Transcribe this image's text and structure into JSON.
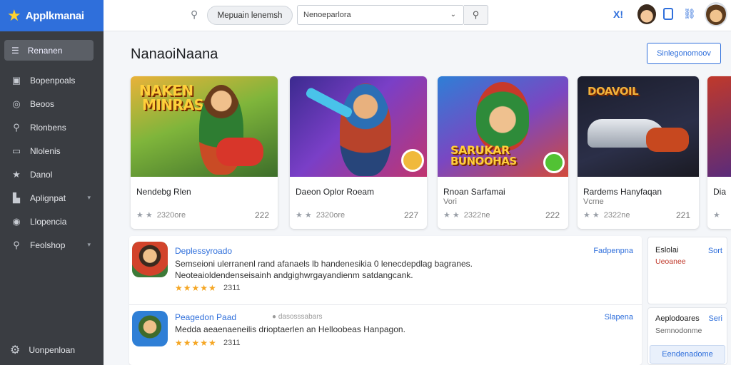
{
  "app": {
    "name": "Applkmanai",
    "logo_icon": "star-icon"
  },
  "sidebar": {
    "active": {
      "label": "Renanen",
      "icon": "menu-icon"
    },
    "items": [
      {
        "label": "Bopenpoals",
        "icon": "inbox-icon",
        "chevron": false
      },
      {
        "label": "Beoos",
        "icon": "bulb-icon",
        "chevron": false
      },
      {
        "label": "Rlonbens",
        "icon": "key-icon",
        "chevron": false
      },
      {
        "label": "Nlolenis",
        "icon": "tablet-icon",
        "chevron": false
      },
      {
        "label": "Danol",
        "icon": "star-icon",
        "chevron": false
      },
      {
        "label": "Aplignpat",
        "icon": "building-icon",
        "chevron": true
      },
      {
        "label": "Llopencia",
        "icon": "circle-icon",
        "chevron": false
      },
      {
        "label": "Feolshop",
        "icon": "search-icon",
        "chevron": true
      }
    ],
    "bottom": {
      "label": "Uonpenloan",
      "icon": "gear-icon"
    }
  },
  "topbar": {
    "pill": "Mepuain lenemsh",
    "select_value": "Nenoeparlora",
    "icon_x": "X!"
  },
  "main": {
    "title": "NanaoiNaana",
    "top_button": "Sinlegonomoov",
    "cards": [
      {
        "headline1": "NAKEN",
        "headline2": "MINRAS",
        "title": "Nendebg Rlen",
        "sub": "",
        "rating": "2320ore",
        "count": "222"
      },
      {
        "headline1": "",
        "headline2": "",
        "title": "Daeon Oplor Roeam",
        "sub": "",
        "rating": "2320ore",
        "count": "227"
      },
      {
        "headline1": "SARUKAR",
        "headline2": "BUNOOHAS",
        "title": "Rnoan Sarfamai",
        "sub": "Vori",
        "rating": "2322ne",
        "count": "222"
      },
      {
        "headline1": "DOAVOIL",
        "headline2": "",
        "title": "Rardems Hanyfaqan",
        "sub": "Vcrne",
        "rating": "2322ne",
        "count": "221"
      },
      {
        "headline1": "",
        "headline2": "",
        "title": "Dia",
        "sub": "",
        "rating": "",
        "count": ""
      }
    ],
    "list": [
      {
        "name": "Deplessyroado",
        "tag": "",
        "desc": "Semseioni ulerranenl rand afanaels lb handenesikia 0 lenecdepdlag bagranes. Neoteaioldendenseisainh andgighwrgayandienm satdangcank.",
        "stars": "★★★★★",
        "reviews": "2311",
        "action": "Fadpenpna"
      },
      {
        "name": "Peagedon Paad",
        "tag": "● dasosssabars",
        "desc": "Medda aeaenaeneilis drioptaerlen an Helloobeas Hanpagon.",
        "stars": "★★★★★",
        "reviews": "2311",
        "action": "Slapena"
      }
    ],
    "panel1": {
      "heading": "Eslolai",
      "action": "Sort",
      "red": "Ueoanee"
    },
    "panel2": {
      "heading": "Aeplodoares",
      "action": "Seri",
      "sub": "Semnodonme",
      "button": "Eendenadome"
    }
  },
  "colors": {
    "accent": "#2f6fdb",
    "sidebar": "#3a3d42",
    "star": "#f5a623"
  }
}
